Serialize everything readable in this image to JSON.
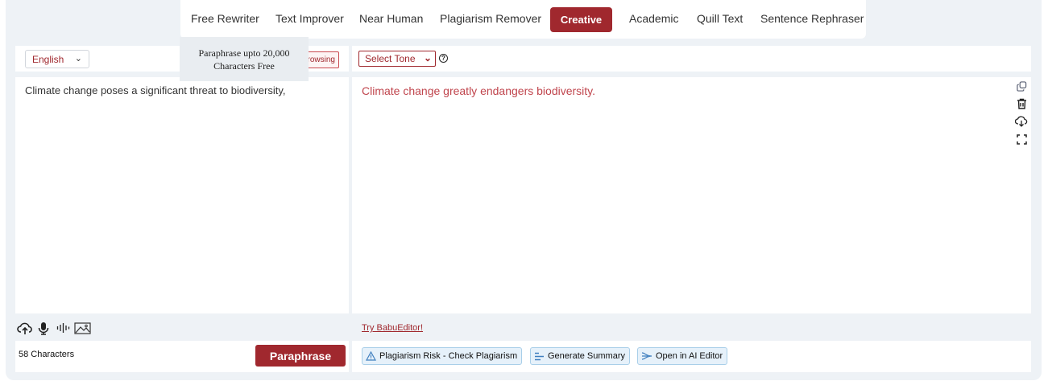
{
  "nav": {
    "tabs": [
      "Free Rewriter",
      "Text Improver",
      "Near Human",
      "Plagiarism Remover",
      "Creative",
      "Academic",
      "Quill Text",
      "Sentence Rephraser"
    ],
    "active_tab": "Creative"
  },
  "left": {
    "language": "English",
    "browsing_badge": "rowsing",
    "tooltip_line1": "Paraphrase upto 20,000",
    "tooltip_line2": "Characters Free",
    "input_text": "Climate change poses a significant threat to biodiversity,",
    "char_count": "58 Characters",
    "paraphrase_label": "Paraphrase",
    "tool_icons": [
      "upload-cloud-icon",
      "microphone-icon",
      "audio-wave-icon",
      "image-icon"
    ]
  },
  "right": {
    "tone_select": "Select Tone",
    "help_icon": "?",
    "output_text": "Climate change greatly endangers biodiversity.",
    "side_icons": [
      "copy-icon",
      "trash-icon",
      "download-icon",
      "fullscreen-icon"
    ],
    "try_link": "Try BabuEditor!",
    "actions": [
      {
        "label": "Plagiarism Risk - Check Plagiarism",
        "icon": "warning-icon"
      },
      {
        "label": "Generate Summary",
        "icon": "summary-icon"
      },
      {
        "label": "Open in AI Editor",
        "icon": "editor-icon"
      }
    ]
  },
  "colors": {
    "accent": "#a0282e",
    "output_text": "#c0454d",
    "background": "#eef2f6",
    "chip_bg": "#e6f1fa"
  }
}
